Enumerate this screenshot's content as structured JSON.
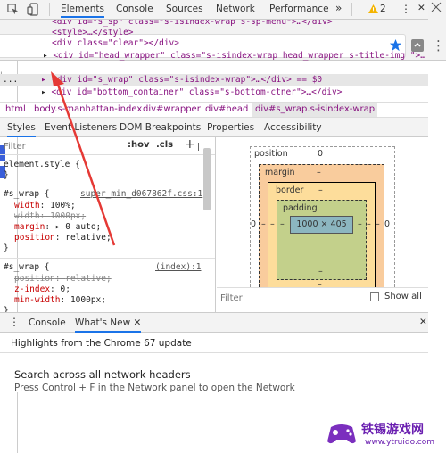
{
  "devtools": {
    "tabs": [
      "Elements",
      "Console",
      "Sources",
      "Network",
      "Performance"
    ],
    "more_tabs": "»",
    "warning_count": "2",
    "kebab": "⋮",
    "close": "✕"
  },
  "elements_lines": [
    "<div id=\"s_sp\" class=\"s-isindex-wrap s-sp-menu\">…</div>",
    "<style>…</style>",
    "<div class=\"clear\"></div>",
    "<div id=\"head_wrapper\" class=\"s-isindex-wrap head_wrapper s-title-img \">…",
    "<div id=\"s_wrap\" class=\"s-isindex-wrap\">…</div> == $0",
    "<div id=\"bottom_container\" class=\"s-bottom-ctner\">…</div>"
  ],
  "selected_dots": "...",
  "breadcrumbs": [
    "html",
    "body.s-manhattan-index",
    "div#wrapper",
    "div#head",
    "div#s_wrap.s-isindex-wrap"
  ],
  "subtabs": [
    "Styles",
    "Event Listeners",
    "DOM Breakpoints",
    "Properties",
    "Accessibility"
  ],
  "styles": {
    "filter_placeholder": "Filter",
    "hov": ":hov",
    "cls": ".cls",
    "plus": "+",
    "element_style_open": "element.style {",
    "close_brace": "}",
    "rule1": {
      "selector": "#s_wrap {",
      "source": "super_min_d067862f.css:1",
      "decls": [
        {
          "prop": "width",
          "value": "100%;"
        },
        {
          "prop": "width",
          "value": "1000px;"
        },
        {
          "prop": "margin",
          "value": "▸ 0 auto;"
        },
        {
          "prop": "position",
          "value": "relative;"
        }
      ]
    },
    "rule2": {
      "selector": "#s_wrap {",
      "source": "(index):1",
      "decls": [
        {
          "prop": "position",
          "value": "relative;"
        },
        {
          "prop": "z-index",
          "value": "0;"
        },
        {
          "prop": "min-width",
          "value": "1000px;"
        }
      ]
    }
  },
  "boxmodel": {
    "position_label": "position",
    "position_value": "0",
    "margin_label": "margin",
    "margin_value": "–",
    "border_label": "border",
    "border_value": "–",
    "padding_label": "padding",
    "padding_value": "–",
    "content": "1000 × 405",
    "left_outer": "0",
    "right_outer": "0",
    "dash": "–",
    "filter_placeholder": "Filter",
    "show_all": "Show all"
  },
  "drawer": {
    "tabs": [
      "Console",
      "What's New"
    ],
    "close_tab": "✕",
    "highlights": "Highlights from the Chrome 67 update",
    "item_title": "Search across all network headers",
    "item_desc": "Press Control + F in the Network panel to open the Network"
  },
  "watermark": {
    "name": "铁锡游戏网",
    "url": "www.ytruido.com"
  },
  "colors": {
    "margin": "#f9cc9d",
    "border": "#fddd9b",
    "padding": "#c3d08b",
    "content": "#8cb6c0",
    "arrow": "#e53935",
    "accent": "#1a73e8"
  }
}
